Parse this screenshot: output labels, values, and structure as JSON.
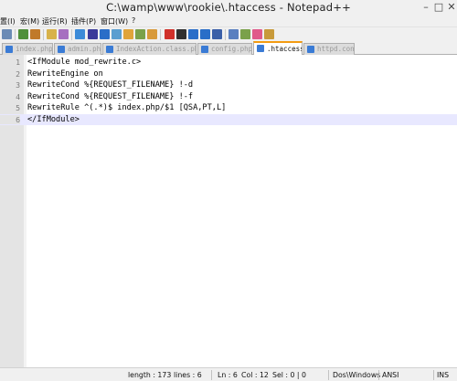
{
  "window": {
    "title": "C:\\wamp\\www\\rookie\\.htaccess - Notepad++"
  },
  "menu": {
    "items": [
      {
        "label": "置(I)"
      },
      {
        "label": "宏(M)"
      },
      {
        "label": "运行(R)"
      },
      {
        "label": "插件(P)"
      },
      {
        "label": "窗口(W)"
      },
      {
        "label": "?"
      }
    ]
  },
  "toolbar": {
    "buttons": [
      {
        "icon": "indent-icon",
        "color": "#6b8bb5"
      },
      {
        "icon": "zoom-in-icon",
        "color": "#4f8f3a"
      },
      {
        "icon": "zoom-out-icon",
        "color": "#c07a2a"
      },
      {
        "icon": "sync-vertical-icon",
        "color": "#d8b24a"
      },
      {
        "icon": "sync-horizontal-icon",
        "color": "#a66fc0"
      },
      {
        "icon": "word-wrap-icon",
        "color": "#3c8bd8"
      },
      {
        "icon": "show-symbols-icon",
        "color": "#3a3a9a"
      },
      {
        "icon": "indent-guide-icon",
        "color": "#2a6ec8"
      },
      {
        "icon": "user-lang-icon",
        "color": "#5a9fd0"
      },
      {
        "icon": "doc-map-icon",
        "color": "#e0a43a"
      },
      {
        "icon": "function-list-icon",
        "color": "#7aa14a"
      },
      {
        "icon": "folder-workspace-icon",
        "color": "#d89a3a"
      },
      {
        "icon": "record-macro-icon",
        "color": "#d0302a"
      },
      {
        "icon": "stop-record-icon",
        "color": "#303030"
      },
      {
        "icon": "play-macro-icon",
        "color": "#2a6ec8"
      },
      {
        "icon": "play-multiple-icon",
        "color": "#2a6ec8"
      },
      {
        "icon": "save-macro-icon",
        "color": "#3a5fa8"
      },
      {
        "icon": "spellcheck-icon",
        "color": "#5a7fc0"
      },
      {
        "icon": "spellcheck-options-icon",
        "color": "#7aa14a"
      },
      {
        "icon": "heart-icon",
        "color": "#e05a8a"
      },
      {
        "icon": "plugin-icon",
        "color": "#c89a3a"
      }
    ]
  },
  "tabs": [
    {
      "label": "index.php",
      "active": false
    },
    {
      "label": "admin.php",
      "active": false
    },
    {
      "label": "IndexAction.class.php",
      "active": false
    },
    {
      "label": "config.php",
      "active": false
    },
    {
      "label": ".htaccess",
      "active": true
    },
    {
      "label": "httpd.conf",
      "active": false
    }
  ],
  "editor": {
    "lines": [
      {
        "number": "1",
        "text": "<IfModule mod_rewrite.c>"
      },
      {
        "number": "2",
        "text": "RewriteEngine on"
      },
      {
        "number": "3",
        "text": "RewriteCond %{REQUEST_FILENAME} !-d"
      },
      {
        "number": "4",
        "text": "RewriteCond %{REQUEST_FILENAME} !-f"
      },
      {
        "number": "5",
        "text": "RewriteRule ^(.*)$ index.php/$1 [QSA,PT,L]"
      },
      {
        "number": "6",
        "text": "</IfModule>"
      }
    ],
    "current_line": "6"
  },
  "status": {
    "length": "length : 173",
    "lines": "lines : 6",
    "ln": "Ln : 6",
    "col": "Col : 12",
    "sel": "Sel : 0 | 0",
    "eol": "Dos\\Windows",
    "encoding": "ANSI",
    "mode": "INS"
  }
}
